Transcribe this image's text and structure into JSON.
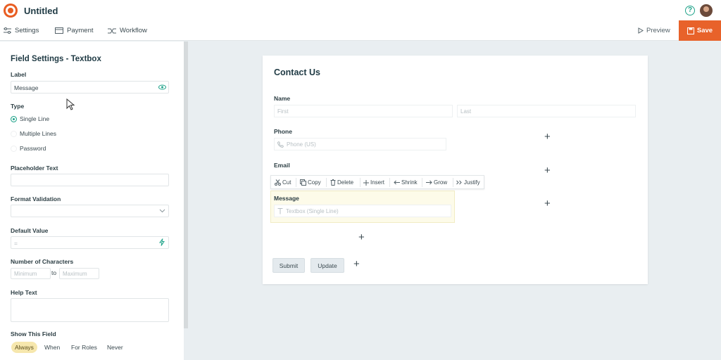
{
  "app": {
    "title": "Untitled"
  },
  "toolbar": {
    "settings_label": "Settings",
    "payment_label": "Payment",
    "workflow_label": "Workflow",
    "preview_label": "Preview",
    "save_label": "Save"
  },
  "panel": {
    "title": "Field Settings - Textbox",
    "label_heading": "Label",
    "label_value": "Message",
    "type_heading": "Type",
    "type_options": [
      "Single Line",
      "Multiple Lines",
      "Password"
    ],
    "type_selected": "Single Line",
    "placeholder_heading": "Placeholder Text",
    "placeholder_value": "",
    "format_heading": "Format Validation",
    "format_value": "",
    "default_heading": "Default Value",
    "default_value": "=",
    "chars_heading": "Number of Characters",
    "chars_min_placeholder": "Minimum",
    "chars_to": "to",
    "chars_max_placeholder": "Maximum",
    "help_heading": "Help Text",
    "show_heading": "Show This Field",
    "show_options": [
      "Always",
      "When",
      "For Roles",
      "Never"
    ],
    "show_selected": "Always"
  },
  "form": {
    "title": "Contact Us",
    "name_label": "Name",
    "first_placeholder": "First",
    "last_placeholder": "Last",
    "phone_label": "Phone",
    "phone_placeholder": "Phone (US)",
    "email_label": "Email",
    "message_label": "Message",
    "message_placeholder": "Textbox (Single Line)",
    "submit_label": "Submit",
    "update_label": "Update"
  },
  "context_menu": {
    "cut": "Cut",
    "copy": "Copy",
    "delete": "Delete",
    "insert": "Insert",
    "shrink": "Shrink",
    "grow": "Grow",
    "justify": "Justify"
  },
  "colors": {
    "accent": "#20a38a",
    "save": "#e8622a",
    "brand": "#e85d22",
    "selected_bg": "#fdfbe9"
  },
  "icons": [
    "logo-icon",
    "help-icon",
    "avatar",
    "settings-icon",
    "payment-icon",
    "workflow-icon",
    "preview-icon",
    "save-icon",
    "eye-icon",
    "bolt-icon",
    "chevron-down-icon",
    "phone-icon",
    "textbox-icon",
    "plus-icon",
    "cut-icon",
    "copy-icon",
    "delete-icon",
    "insert-icon",
    "shrink-icon",
    "grow-icon",
    "justify-icon",
    "mouse-cursor-icon"
  ]
}
